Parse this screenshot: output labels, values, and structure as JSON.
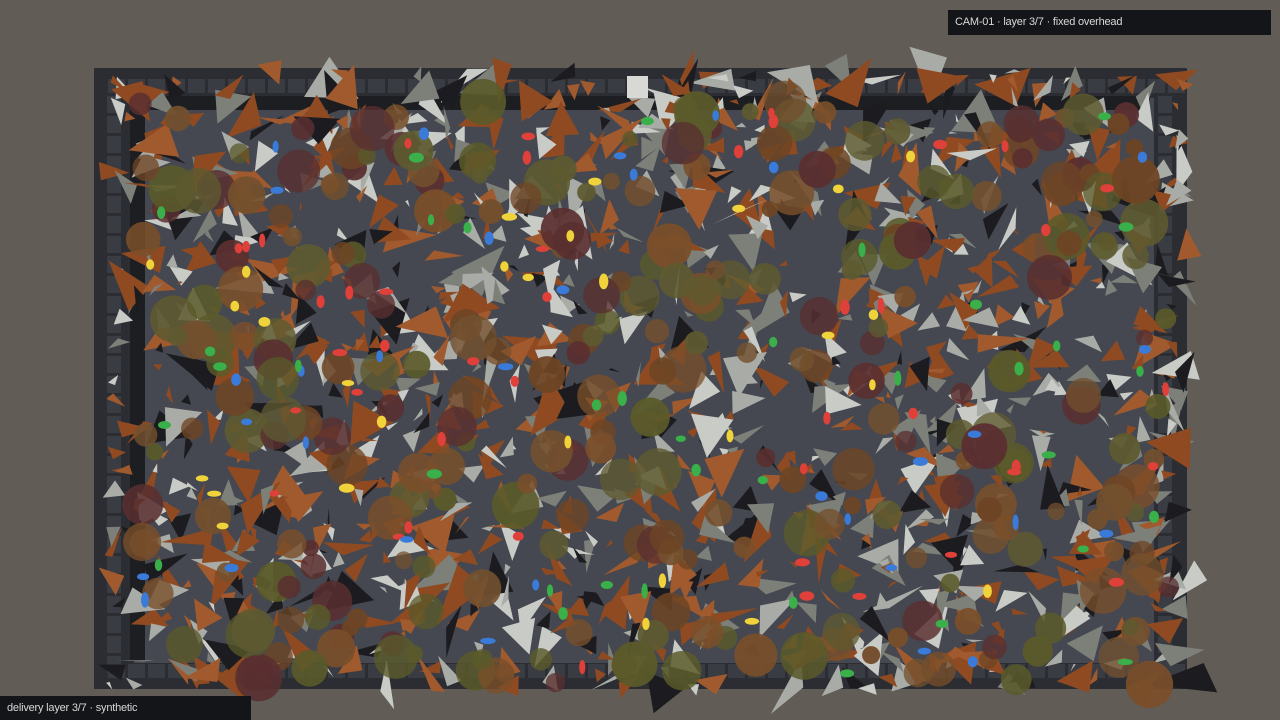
{
  "camera_label": "CAM-01 · layer 3/7 · fixed overhead",
  "footer_label": "delivery layer 3/7 · synthetic",
  "colors": {
    "background": "#615c55",
    "bin_frame": "#2b2d33",
    "bin_floor": "#454850",
    "bin_inner_shadow": "#1d1e22",
    "shard_gray": "#a9aca6",
    "shard_rust": "#8f4a22",
    "shard_dark": "#1c1c20",
    "blob_brown": "#7a4f2a",
    "blob_olive": "#5a5a2a",
    "blob_maroon": "#5a2f30",
    "dot_red": "#e0403a",
    "dot_yellow": "#f0d23a",
    "dot_blue": "#3a7ad8",
    "dot_green": "#3ab04a",
    "hud_bg": "#141518",
    "hud_text": "#d9d9d9"
  }
}
